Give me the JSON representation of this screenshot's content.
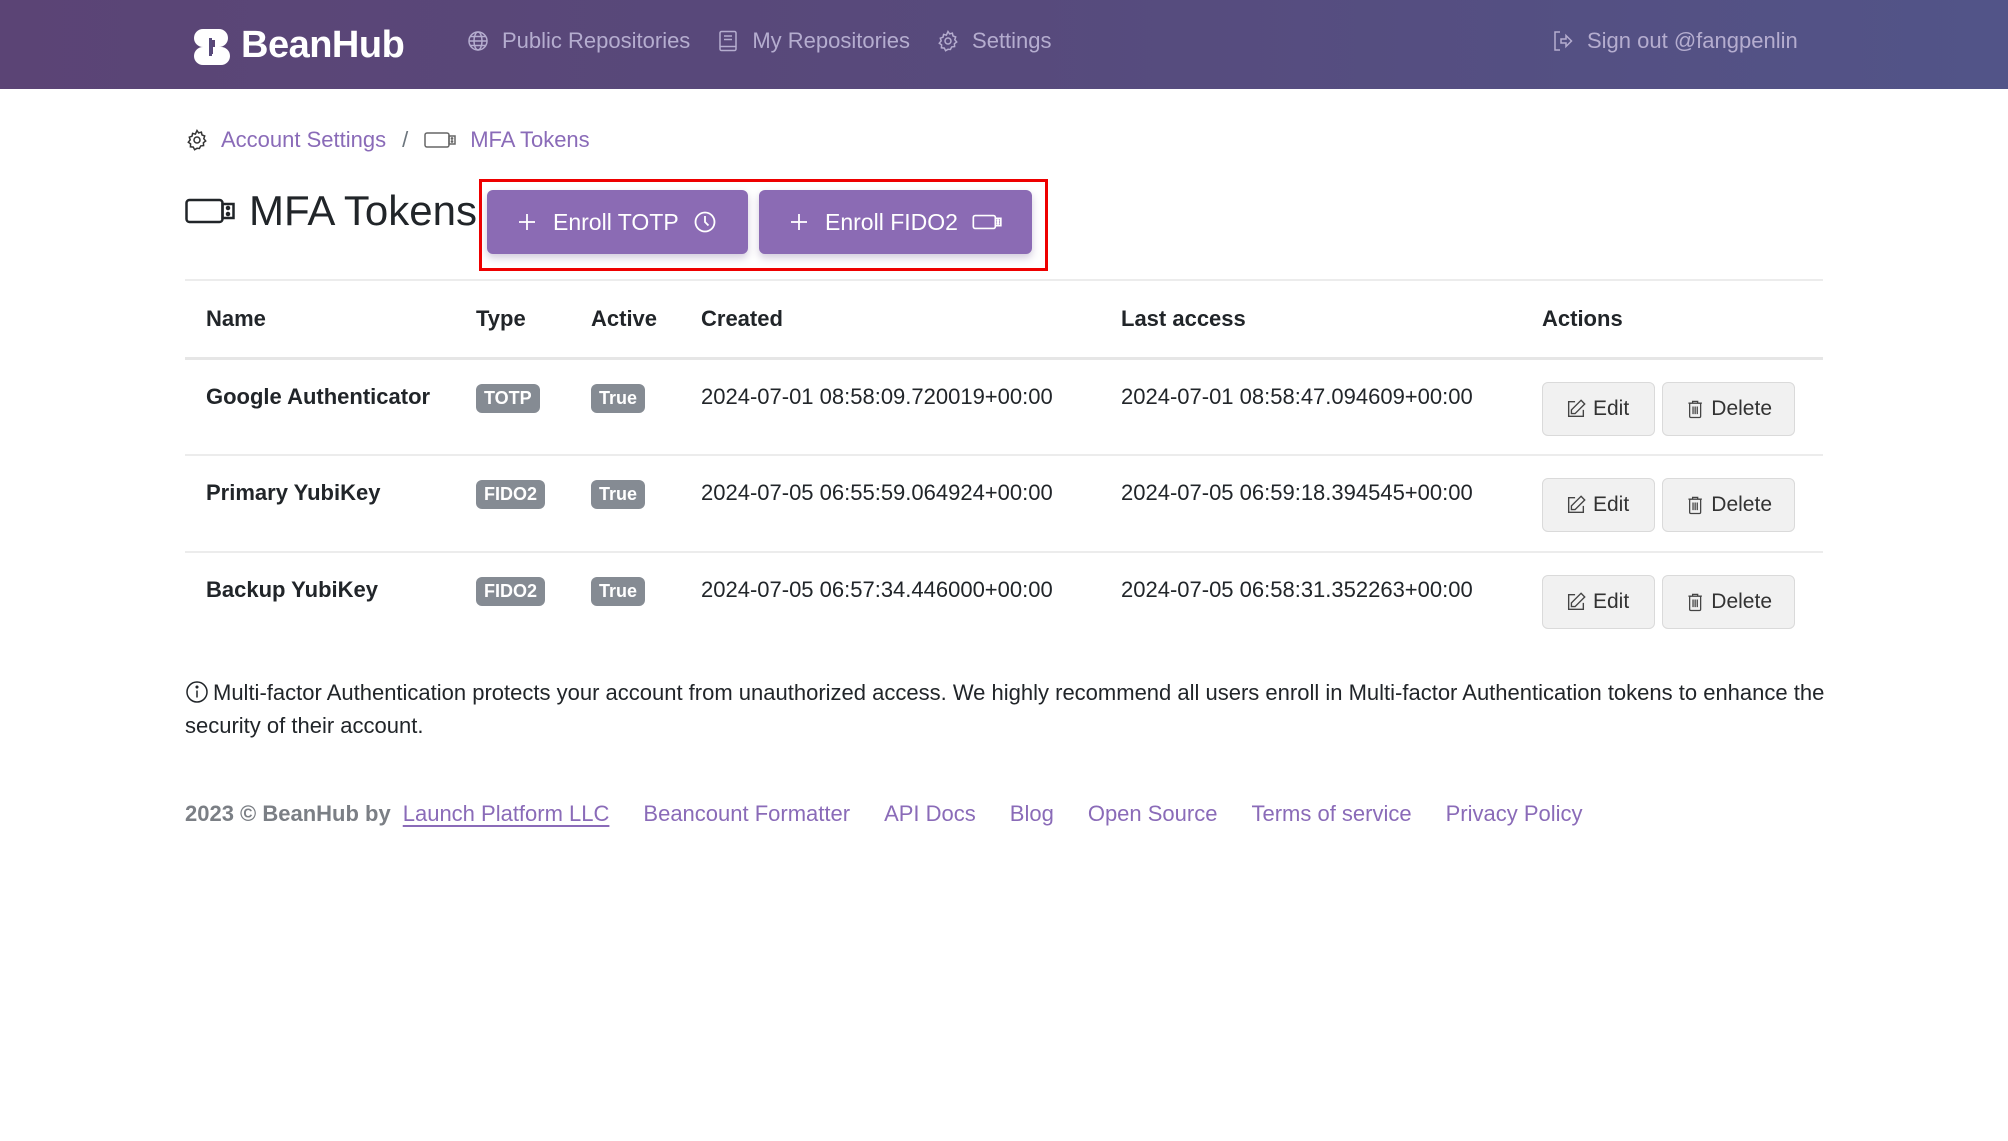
{
  "navbar": {
    "brand": "BeanHub",
    "links": [
      {
        "label": "Public Repositories",
        "icon": "globe-icon"
      },
      {
        "label": "My Repositories",
        "icon": "book-icon"
      },
      {
        "label": "Settings",
        "icon": "gear-icon"
      }
    ],
    "sign_out": "Sign out @fangpenlin"
  },
  "breadcrumb": {
    "items": [
      {
        "label": "Account Settings",
        "icon": "gear-icon"
      },
      {
        "label": "MFA Tokens",
        "icon": "usb-key-icon"
      }
    ],
    "separator": "/"
  },
  "page": {
    "title": "MFA Tokens",
    "enroll_totp": "Enroll TOTP",
    "enroll_fido2": "Enroll FIDO2"
  },
  "table": {
    "headers": [
      "Name",
      "Type",
      "Active",
      "Created",
      "Last access",
      "Actions"
    ],
    "rows": [
      {
        "name": "Google Authenticator",
        "type": "TOTP",
        "active": "True",
        "created": "2024-07-01 08:58:09.720019+00:00",
        "last_access": "2024-07-01 08:58:47.094609+00:00"
      },
      {
        "name": "Primary YubiKey",
        "type": "FIDO2",
        "active": "True",
        "created": "2024-07-05 06:55:59.064924+00:00",
        "last_access": "2024-07-05 06:59:18.394545+00:00"
      },
      {
        "name": "Backup YubiKey",
        "type": "FIDO2",
        "active": "True",
        "created": "2024-07-05 06:57:34.446000+00:00",
        "last_access": "2024-07-05 06:58:31.352263+00:00"
      }
    ],
    "edit_label": "Edit",
    "delete_label": "Delete"
  },
  "info_note": "Multi-factor Authentication protects your account from unauthorized access. We highly recommend all users enroll in Multi-factor Authentication tokens to enhance the security of their account.",
  "footer": {
    "copyright": "2023 © BeanHub by",
    "company": "Launch Platform LLC",
    "links": [
      "Beancount Formatter",
      "API Docs",
      "Blog",
      "Open Source",
      "Terms of service",
      "Privacy Policy"
    ]
  },
  "colors": {
    "navbar_start": "#5b4475",
    "navbar_end": "#525488",
    "accent": "#8b6bb4",
    "link": "#8a6bb8",
    "badge": "#858b93",
    "highlight_box": "#ee0000"
  }
}
